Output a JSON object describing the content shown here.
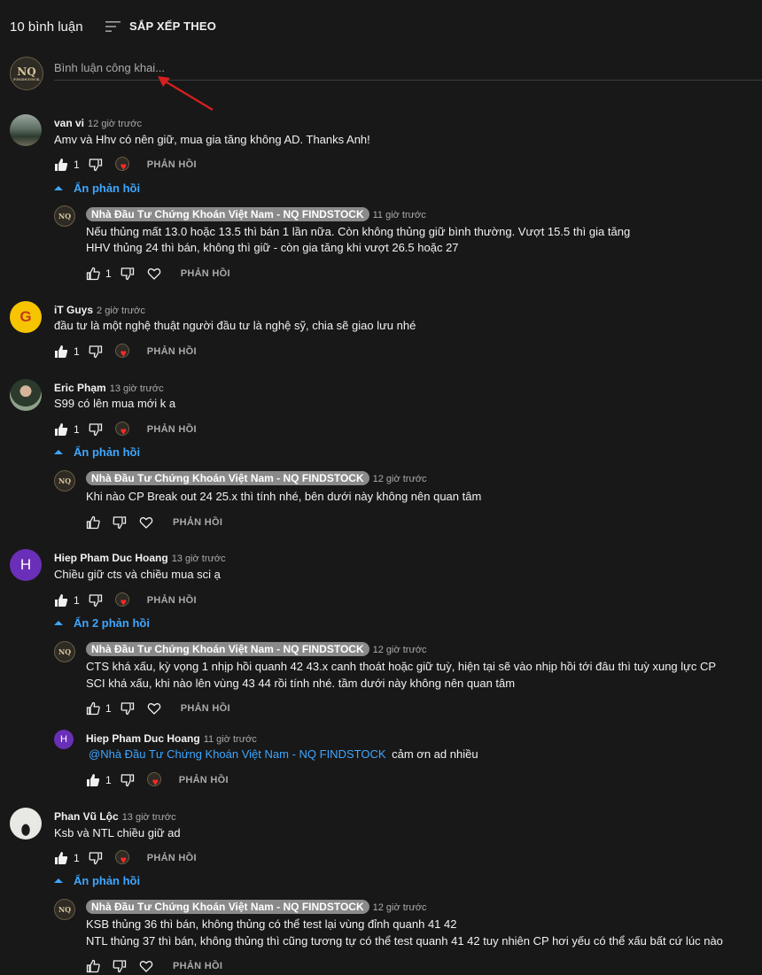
{
  "header": {
    "count_label": "10 bình luận",
    "sort_label": "SẮP XẾP THEO"
  },
  "compose": {
    "placeholder": "Bình luận công khai...",
    "avatar_text": "NQ",
    "avatar_sub": "FINDSTOCK"
  },
  "channel": {
    "name": "Nhà Đầu Tư Chứng Khoán Việt Nam - NQ FINDSTOCK",
    "avatar_text": "NQ"
  },
  "reply_label": "PHẢN HỒI",
  "comments": [
    {
      "author": "van vi",
      "time": "12 giờ trước",
      "text": "Amv và Hhv có nên giữ, mua gia tăng không AD. Thanks Anh!",
      "likes": "1",
      "toggle": "Ẩn phản hồi"
    },
    {
      "author": "iT Guys",
      "time": "2 giờ trước",
      "text": "đầu tư là một nghệ thuật người đầu tư là nghệ sỹ, chia sẽ giao lưu nhé",
      "likes": "1",
      "avatar_letter": "G"
    },
    {
      "author": "Eric Phạm",
      "time": "13 giờ trước",
      "text": "S99 có lên mua mới k a",
      "likes": "1",
      "toggle": "Ẩn phản hồi"
    },
    {
      "author": "Hiep Pham Duc Hoang",
      "time": "13 giờ trước",
      "text": "Chiều giữ cts và chiều mua sci ạ",
      "likes": "1",
      "toggle": "Ẩn 2 phản hồi",
      "avatar_letter": "H"
    },
    {
      "author": "Phan Vũ Lộc",
      "time": "13 giờ trước",
      "text": "Ksb và NTL chiều giữ ad",
      "likes": "1",
      "toggle": "Ẩn phản hồi"
    }
  ],
  "replies": [
    {
      "time": "11 giờ trước",
      "line1": "Nếu thủng mất 13.0 hoặc 13.5 thì bán 1 lần nữa. Còn không thủng giữ bình thường. Vượt 15.5 thì gia tăng",
      "line2": "HHV thủng 24 thì bán, không thì giữ  - còn gia tăng khi vượt 26.5 hoặc 27",
      "likes": "1"
    },
    {
      "time": "12 giờ trước",
      "line1": "Khi nào CP Break out 24 25.x thì tính nhé, bên dưới này không nên quan tâm"
    },
    {
      "time": "12 giờ trước",
      "line1": "CTS khá xấu, kỳ vọng 1 nhịp hồi quanh 42 43.x canh thoát hoặc giữ tuỳ, hiện tại sẽ vào nhịp hồi tới đâu thì tuỳ xung lực CP",
      "line2": "SCI khá xấu, khi nào lên vùng 43 44 rồi tính nhé. tầm dưới này không nên quan tâm",
      "likes": "1"
    },
    {
      "author": "Hiep Pham Duc Hoang",
      "time": "11 giờ trước",
      "mention": "@Nhà Đầu Tư Chứng Khoán Việt Nam - NQ FINDSTOCK",
      "text": "cảm ơn ad nhiều",
      "likes": "1",
      "avatar_letter": "H"
    },
    {
      "time": "12 giờ trước",
      "line1": "KSB thủng 36 thì bán, không thủng có thể test lại vùng đỉnh quanh 41 42",
      "line2": "NTL thủng 37 thì bán, không thủng thì cũng tương tự có thể test quanh 41 42 tuy nhiên CP hơi yếu có thể xấu bất cứ lúc nào"
    }
  ],
  "colors": {
    "background": "#181818",
    "link": "#3ea6ff",
    "heart": "#ff2a2a"
  }
}
